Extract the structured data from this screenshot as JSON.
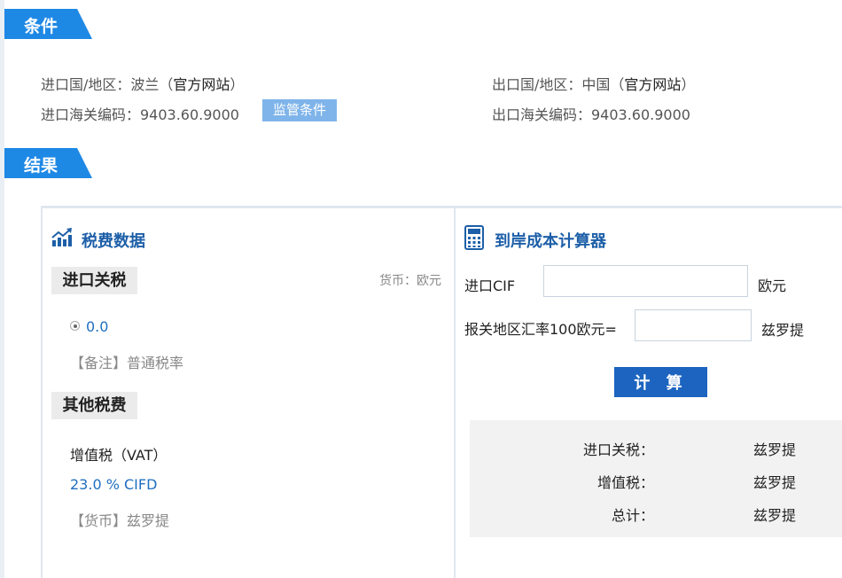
{
  "sections": {
    "conditions": "条件",
    "results": "结果"
  },
  "conditions": {
    "import_country_label": "进口国/地区：波兰（",
    "import_site_link": "官方网站",
    "close_paren": "）",
    "import_hs_code": "进口海关编码：9403.60.9000",
    "supervision_badge": "监管条件",
    "export_country_label": "出口国/地区：中国（",
    "export_site_link": "官方网站",
    "export_hs_code": "出口海关编码：9403.60.9000"
  },
  "tax_panel": {
    "title": "税费数据",
    "import_duty_label": "进口关税",
    "currency_note": "货币：欧元",
    "duty_value": "0.0",
    "duty_remark": "【备注】普通税率",
    "other_tax_label": "其他税费",
    "vat_name": "增值税（VAT）",
    "vat_rate": "23.0 % CIFD",
    "vat_currency": "【货币】兹罗提"
  },
  "calculator": {
    "title": "到岸成本计算器",
    "cif_label": "进口CIF",
    "cif_value": "",
    "cif_unit": "欧元",
    "rate_label": "报关地区汇率100欧元=",
    "rate_value": "",
    "rate_unit": "兹罗提",
    "calc_button": "计 算",
    "results": [
      {
        "label": "进口关税：",
        "unit": "兹罗提"
      },
      {
        "label": "增值税：",
        "unit": "兹罗提"
      },
      {
        "label": "总计：",
        "unit": "兹罗提"
      }
    ]
  },
  "icons": {
    "tax": "chart-up-icon",
    "calculator": "calculator-icon"
  },
  "colors": {
    "accent": "#1e88e5",
    "title_blue": "#1d5fa8",
    "button": "#1c64c0",
    "badge": "#7fb4ea"
  }
}
